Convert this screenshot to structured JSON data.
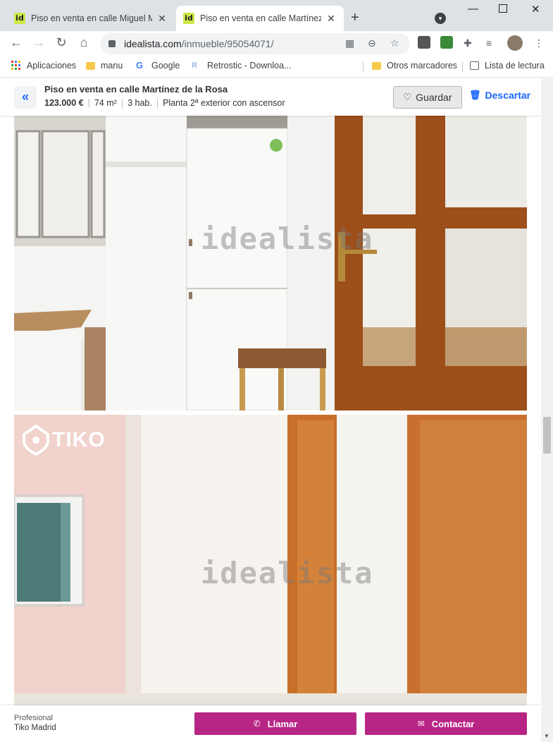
{
  "browser": {
    "tabs": [
      {
        "title": "Piso en venta en calle Miguel Mo",
        "favicon": "id",
        "active": false
      },
      {
        "title": "Piso en venta en calle Martínez d",
        "favicon": "id",
        "active": true
      }
    ],
    "new_tab": "+",
    "url_host": "idealista.com",
    "url_path": "/inmueble/95054071/",
    "bookmarks": [
      {
        "label": "Aplicaciones",
        "icon": "apps-grid-icon"
      },
      {
        "label": "manu",
        "icon": "folder-icon"
      },
      {
        "label": "Google",
        "icon": "google-icon"
      },
      {
        "label": "Retrostic - Downloa...",
        "icon": "retrostic-icon"
      },
      {
        "label": "Otros marcadores",
        "icon": "folder-icon"
      },
      {
        "label": "Lista de lectura",
        "icon": "reading-list-icon"
      }
    ]
  },
  "header": {
    "back_glyph": "«",
    "title": "Piso en venta en calle Martínez de la Rosa",
    "price": "123.000 €",
    "area": "74 m²",
    "rooms": "3 hab.",
    "floor": "Planta 2ª exterior con ascensor",
    "save_label": "Guardar",
    "discard_label": "Descartar"
  },
  "gallery": {
    "watermark": "idealista",
    "agency_logo": "TIKO"
  },
  "footer": {
    "pro_label": "Profesional",
    "pro_name": "Tiko Madrid",
    "call_label": "Llamar",
    "contact_label": "Contactar"
  },
  "colors": {
    "accent_blue": "#1a66ff",
    "cta_magenta": "#b82685",
    "favicon_green": "#cbe847"
  }
}
